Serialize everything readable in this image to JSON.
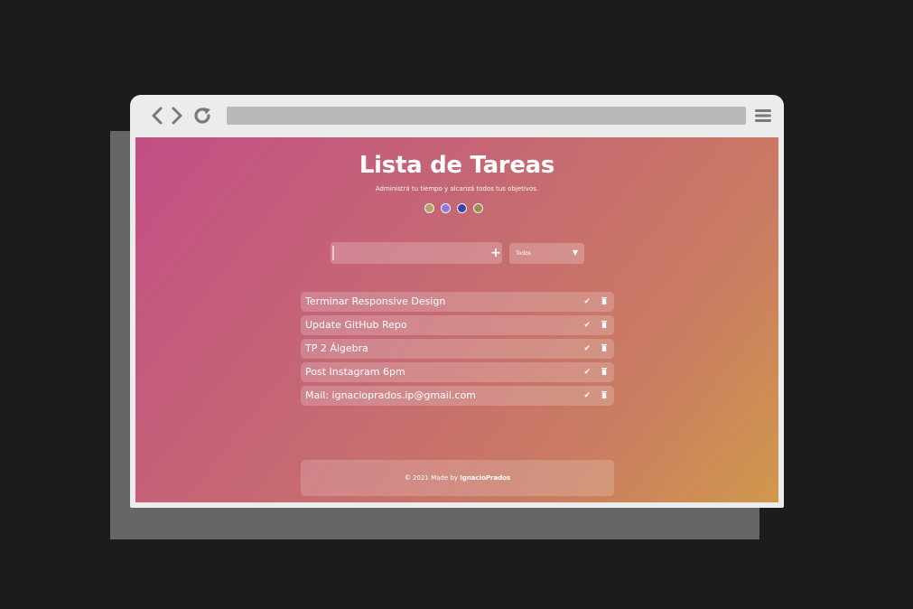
{
  "app": {
    "title": "Lista de Tareas",
    "subtitle": "Administrá tu tiempo y alcanzá todos tus objetivos."
  },
  "themes": [
    {
      "name": "theme-1",
      "color": "#b9a26a"
    },
    {
      "name": "theme-2",
      "color": "#8b7ad6"
    },
    {
      "name": "theme-3",
      "color": "#3a44b0"
    },
    {
      "name": "theme-4",
      "color": "#9b8f52"
    }
  ],
  "input": {
    "value": "",
    "placeholder": ""
  },
  "add_button": {
    "label": "+"
  },
  "filter": {
    "selected": "Todos"
  },
  "tasks": [
    {
      "text": "Terminar Responsive Design"
    },
    {
      "text": "Update GitHub Repo"
    },
    {
      "text": "TP 2 Álgebra"
    },
    {
      "text": "Post Instagram 6pm"
    },
    {
      "text": "Mail: ignacioprados.ip@gmail.com"
    }
  ],
  "footer": {
    "prefix": "© 2021 Made by",
    "author": "IgnacioPrados"
  },
  "icons": {
    "back": "chevron-left-icon",
    "forward": "chevron-right-icon",
    "reload": "reload-icon",
    "menu": "hamburger-icon",
    "check": "check-icon",
    "trash": "trash-icon"
  }
}
